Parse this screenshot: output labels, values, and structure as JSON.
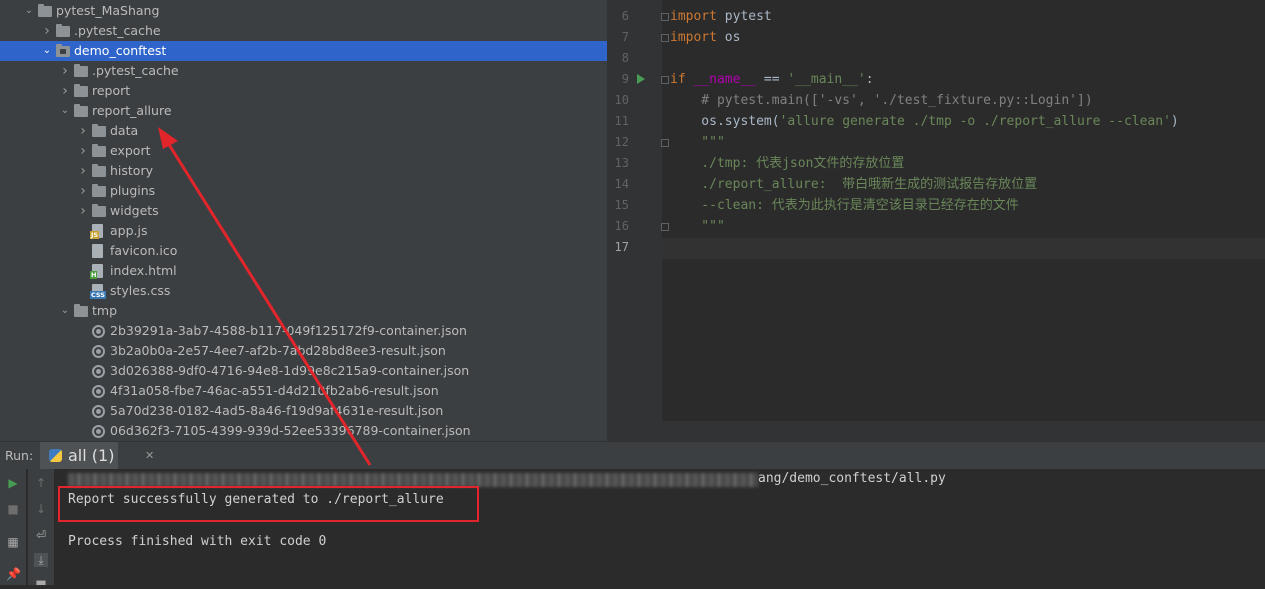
{
  "project_tree": {
    "rows": [
      {
        "label": "pytest_MaShang",
        "icon": "folder-icon",
        "expanded": true
      },
      {
        "label": ".pytest_cache",
        "icon": "folder-icon",
        "expanded": false
      },
      {
        "label": "demo_conftest",
        "icon": "module-folder-icon",
        "expanded": true,
        "selected": true
      },
      {
        "label": ".pytest_cache",
        "icon": "folder-icon",
        "expanded": false
      },
      {
        "label": "report",
        "icon": "folder-icon",
        "expanded": false
      },
      {
        "label": "report_allure",
        "icon": "folder-icon",
        "expanded": true
      },
      {
        "label": "data",
        "icon": "folder-icon",
        "expanded": false
      },
      {
        "label": "export",
        "icon": "folder-icon",
        "expanded": false
      },
      {
        "label": "history",
        "icon": "folder-icon",
        "expanded": false
      },
      {
        "label": "plugins",
        "icon": "folder-icon",
        "expanded": false
      },
      {
        "label": "widgets",
        "icon": "folder-icon",
        "expanded": false
      },
      {
        "label": "app.js",
        "icon": "js-file-icon",
        "tag": "JS"
      },
      {
        "label": "favicon.ico",
        "icon": "image-file-icon"
      },
      {
        "label": "index.html",
        "icon": "html-file-icon",
        "tag": "H"
      },
      {
        "label": "styles.css",
        "icon": "css-file-icon",
        "tag": "CSS"
      },
      {
        "label": "tmp",
        "icon": "folder-icon",
        "expanded": true
      },
      {
        "label": "2b39291a-3ab7-4588-b117-049f125172f9-container.json",
        "icon": "json-file-icon"
      },
      {
        "label": "3b2a0b0a-2e57-4ee7-af2b-7abd28bd8ee3-result.json",
        "icon": "json-file-icon"
      },
      {
        "label": "3d026388-9df0-4716-94e8-1d99e8c215a9-container.json",
        "icon": "json-file-icon"
      },
      {
        "label": "4f31a058-fbe7-46ac-a551-d4d210fb2ab6-result.json",
        "icon": "json-file-icon"
      },
      {
        "label": "5a70d238-0182-4ad5-8a46-f19d9af4631e-result.json",
        "icon": "json-file-icon"
      },
      {
        "label": "06d362f3-7105-4399-939d-52ee53396789-container.json",
        "icon": "json-file-icon"
      }
    ]
  },
  "editor": {
    "line_numbers": [
      "6",
      "7",
      "8",
      "9",
      "10",
      "11",
      "12",
      "13",
      "14",
      "15",
      "16",
      "17"
    ],
    "lines": {
      "l6_kw": "import",
      "l6_rest": " pytest",
      "l7_kw": "import",
      "l7_rest": " os",
      "l9_kw": "if",
      "l9_a": " ",
      "l9_name": "__name__",
      "l9_b": " == ",
      "l9_str": "'__main__'",
      "l9_c": ":",
      "l10_cmt": "    # pytest.main(['-vs', './test_fixture.py::Login'])",
      "l11_a": "    os.system(",
      "l11_str": "'allure generate ./tmp -o ./report_allure --clean'",
      "l11_b": ")",
      "l12": "    \"\"\"",
      "l13": "    ./tmp: 代表json文件的存放位置",
      "l14": "    ./report_allure:  带白哦新生成的测试报告存放位置",
      "l15": "    --clean: 代表为此执行是清空该目录已经存在的文件",
      "l16": "    \"\"\"",
      "l17": ""
    }
  },
  "run_panel": {
    "run_label": "Run:",
    "tab_label": "all (1)",
    "command_tail": "ang/demo_conftest/all.py",
    "line_report": "Report successfully generated to ./report_allure",
    "line_process": "Process finished with exit code 0"
  },
  "colors": {
    "selection": "#2f65ca",
    "annotation_red": "#e2252b",
    "run_green": "#499c54"
  }
}
